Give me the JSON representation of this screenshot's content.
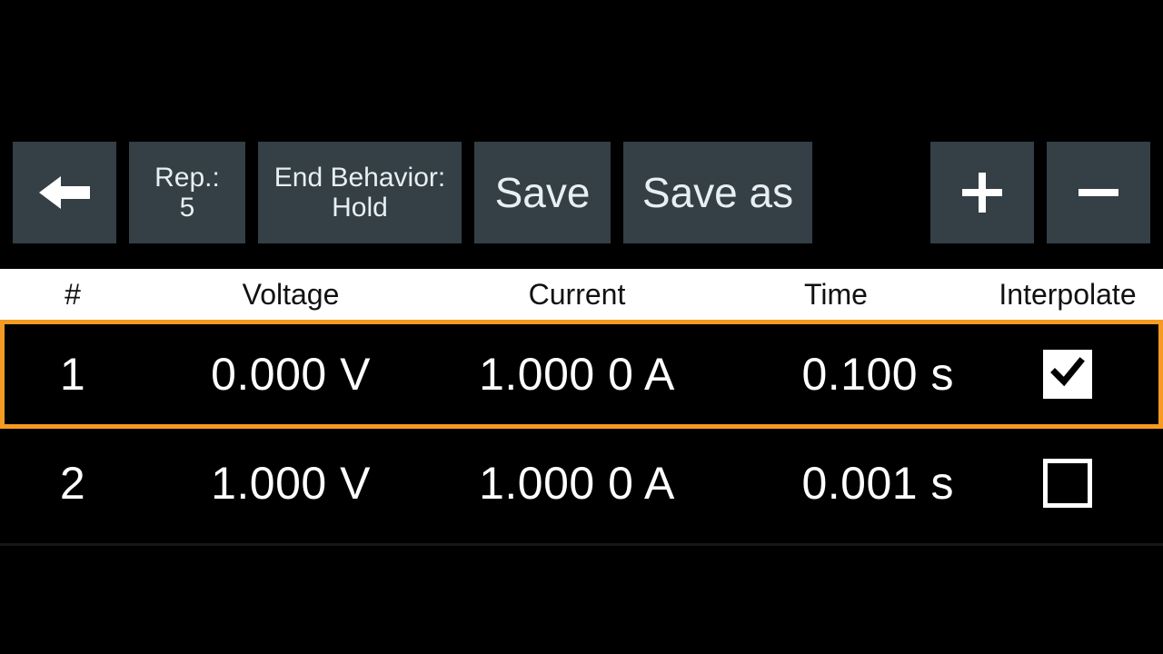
{
  "toolbar": {
    "back_icon": "arrow-left",
    "rep_label": "Rep.:",
    "rep_value": "5",
    "end_label": "End Behavior:",
    "end_value": "Hold",
    "save_label": "Save",
    "saveas_label": "Save as",
    "add_icon": "plus",
    "remove_icon": "minus"
  },
  "table": {
    "headers": {
      "index": "#",
      "voltage": "Voltage",
      "current": "Current",
      "time": "Time",
      "interpolate": "Interpolate"
    },
    "rows": [
      {
        "index": "1",
        "voltage": "0.000 V",
        "current": "1.000 0 A",
        "time": "0.100 s",
        "interpolate": true,
        "selected": true
      },
      {
        "index": "2",
        "voltage": "1.000 V",
        "current": "1.000 0 A",
        "time": "0.001 s",
        "interpolate": false,
        "selected": false
      }
    ]
  },
  "colors": {
    "button_bg": "#343F46",
    "selection": "#F59A22"
  }
}
